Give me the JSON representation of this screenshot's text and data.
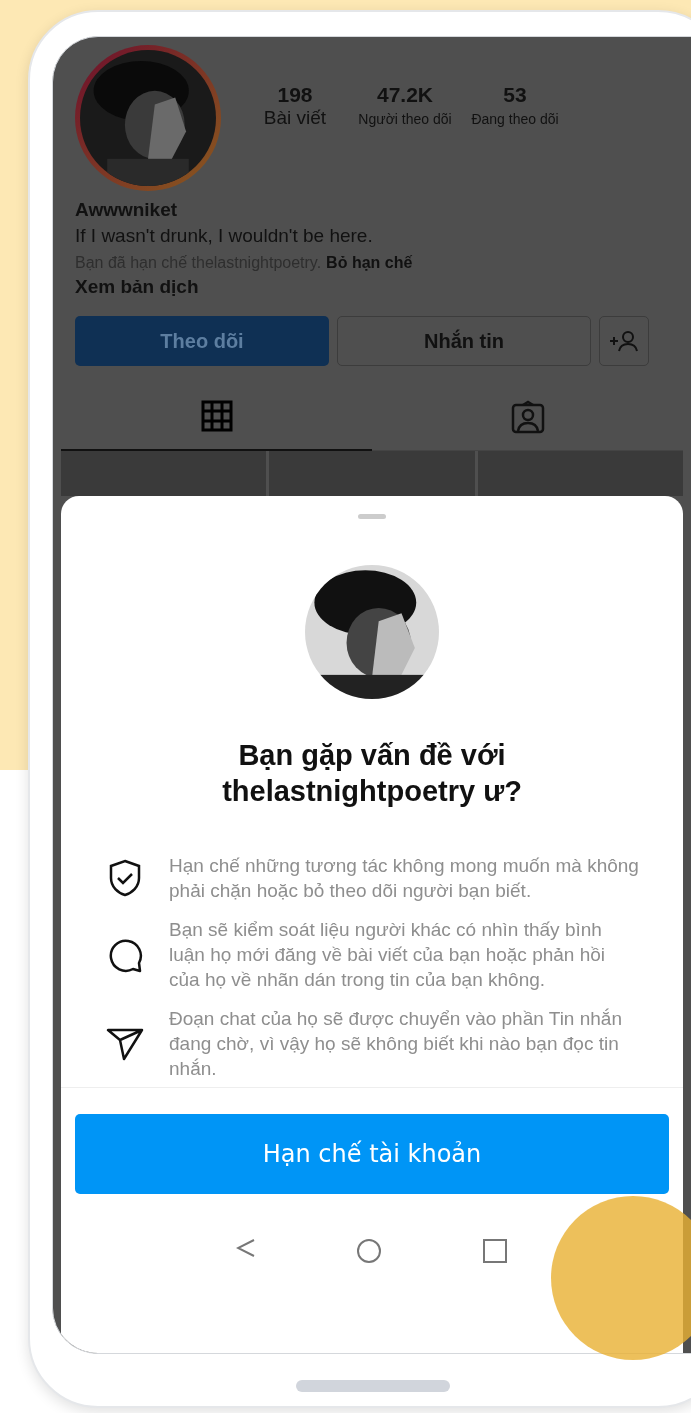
{
  "profile": {
    "stats": [
      {
        "value": "198",
        "label": "Bài viết"
      },
      {
        "value": "47.2K",
        "label": "Người theo dõi"
      },
      {
        "value": "53",
        "label": "Đang theo dõi"
      }
    ],
    "name": "Awwwniket",
    "bio": "If I wasn't drunk, I wouldn't be here.",
    "restricted_notice": "Bạn đã hạn chế thelastnightpoetry.",
    "unrestrict_link": "Bỏ hạn chế",
    "translate_link": "Xem bản dịch",
    "buttons": [
      {
        "kind": "primary",
        "label": "Theo dõi"
      },
      {
        "kind": "secondary",
        "label": "Nhắn tin"
      },
      {
        "kind": "add-person"
      }
    ],
    "tabs": [
      {
        "kind": "grid",
        "selected": true
      },
      {
        "kind": "tagged",
        "selected": false
      }
    ]
  },
  "sheet": {
    "title": "Bạn gặp vấn đề với thelastnightpoetry ư?",
    "items": [
      {
        "kind": "shield",
        "text": "Hạn chế những tương tác không mong muốn mà không phải chặn hoặc bỏ theo dõi người bạn biết."
      },
      {
        "kind": "comment",
        "text": "Bạn sẽ kiểm soát liệu người khác có nhìn thấy bình luận họ mới đăng về bài viết của bạn hoặc phản hồi của họ về nhãn dán trong tin của bạn không."
      },
      {
        "kind": "send",
        "text": "Đoạn chat của họ sẽ được chuyển vào phần Tin nhắn đang chờ, vì vậy họ sẽ không biết khi nào bạn đọc tin nhắn."
      }
    ],
    "action": "Hạn chế tài khoản"
  }
}
